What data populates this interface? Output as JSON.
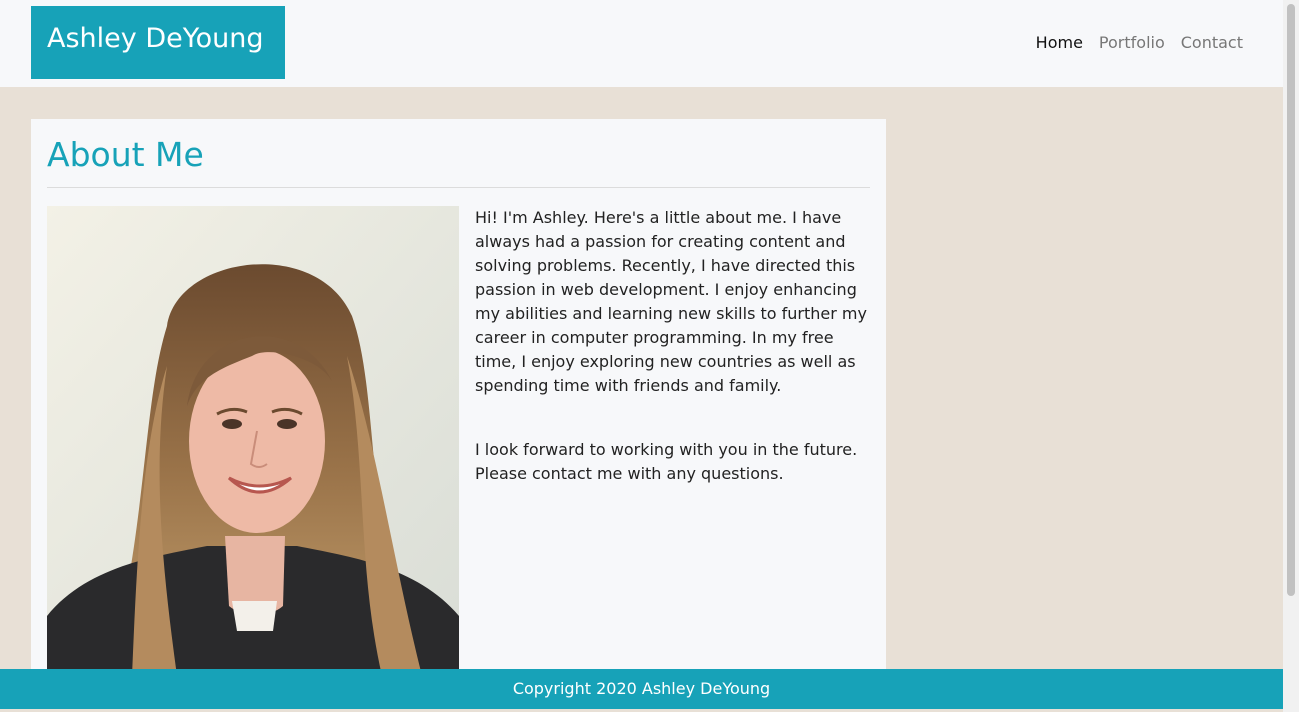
{
  "navbar": {
    "brand": "Ashley DeYoung",
    "links": [
      {
        "label": "Home",
        "active": true
      },
      {
        "label": "Portfolio",
        "active": false
      },
      {
        "label": "Contact",
        "active": false
      }
    ]
  },
  "about": {
    "title": "About Me",
    "paragraph1": "Hi! I'm Ashley. Here's a little about me. I have always had a passion for creating content and solving problems. Recently, I have directed this passion in web development. I enjoy enhancing my abilities and learning new skills to further my career in computer programming. In my free time, I enjoy exploring new countries as well as spending time with friends and family.",
    "paragraph2": "I look forward to working with you in the future. Please contact me with any questions."
  },
  "footer": {
    "text": "Copyright 2020 Ashley DeYoung"
  },
  "colors": {
    "accent": "#17a2b8",
    "page_background": "#e8e0d6",
    "card_background": "#f7f8fa"
  }
}
